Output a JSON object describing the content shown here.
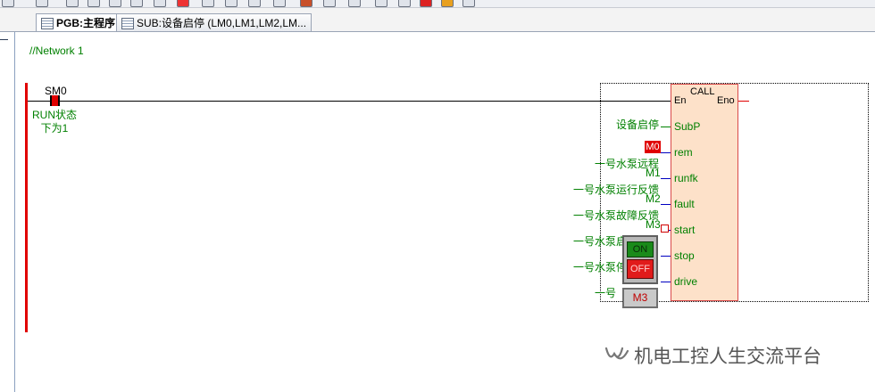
{
  "tabs": [
    {
      "label": "PGB:主程序",
      "active": true
    },
    {
      "label": "SUB:设备启停 (LM0,LM1,LM2,LM...",
      "active": false
    }
  ],
  "ladder": {
    "network_label": "//Network 1",
    "contact": {
      "name": "SM0",
      "comment_line1": "RUN状态",
      "comment_line2": "下为1"
    },
    "call_block": {
      "title": "CALL",
      "en": "En",
      "eno": "Eno",
      "pins": [
        "SubP",
        "rem",
        "runfk",
        "fault",
        "start",
        "stop",
        "drive"
      ]
    },
    "inputs": {
      "subp": "设备启停",
      "rem_addr": "M0",
      "rem_comment": "一号水泵远程",
      "runfk_addr": "M1",
      "runfk_comment": "一号水泵运行反馈",
      "fault_addr": "M2",
      "fault_comment": "一号水泵故障反馈",
      "start_addr": "M3",
      "start_comment": "一号水泵启",
      "stop_comment": "一号水泵停",
      "drive_comment": "一号"
    },
    "switch": {
      "on_label": "ON",
      "off_label": "OFF",
      "address": "M3"
    }
  },
  "watermark": {
    "text": "机电工控人生交流平台",
    "icon": "wechat-channel-icon"
  },
  "colors": {
    "rail": "#e00000",
    "comment": "#008000",
    "block_fill": "#fde1c9",
    "block_border": "#d94a4a"
  }
}
